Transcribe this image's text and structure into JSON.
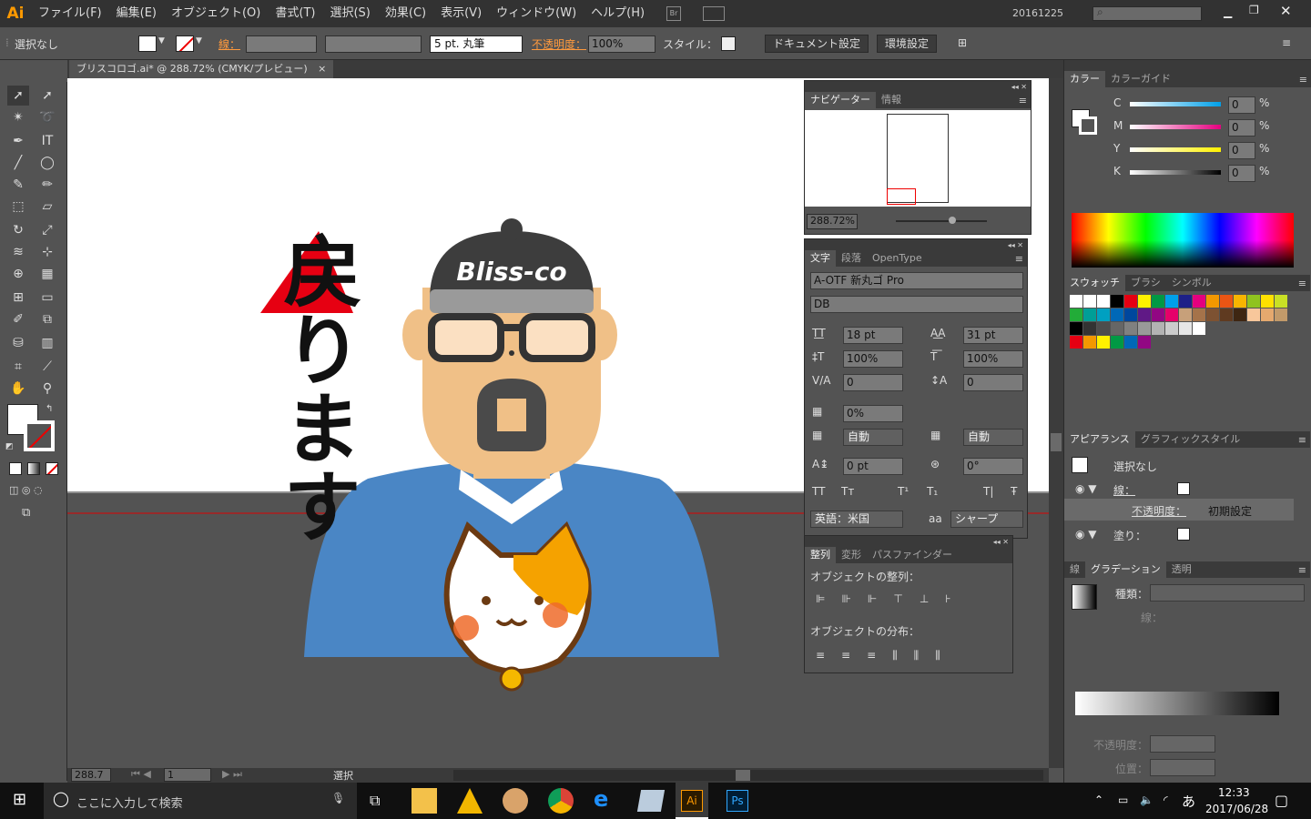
{
  "app": {
    "logo": "Ai"
  },
  "menu": [
    "ファイル(F)",
    "編集(E)",
    "オブジェクト(O)",
    "書式(T)",
    "選択(S)",
    "効果(C)",
    "表示(V)",
    "ウィンドウ(W)",
    "ヘルプ(H)"
  ],
  "workspace": "20161225",
  "control": {
    "selection": "選択なし",
    "stroke_label": "線：",
    "brush": "5 pt. 丸筆",
    "opacity_label": "不透明度：",
    "opacity": "100%",
    "style_label": "スタイル：",
    "doc_setup": "ドキュメント設定",
    "prefs": "環境設定"
  },
  "document": {
    "tab": "ブリスコロゴ.ai* @ 288.72% (CMYK/プレビュー)"
  },
  "artwork": {
    "vertical_text": "戻ります",
    "cap_text": "Bliss-co",
    "triangle_color": "#e60012"
  },
  "status": {
    "zoom": "288.7",
    "artboard": "1",
    "tool": "選択"
  },
  "navigator": {
    "tabs": [
      "ナビゲーター",
      "情報"
    ],
    "zoom": "288.72%"
  },
  "character": {
    "tabs": [
      "文字",
      "段落",
      "OpenType"
    ],
    "font": "A-OTF 新丸ゴ Pro",
    "style": "DB",
    "size": "18 pt",
    "leading": "31 pt",
    "vscale": "100%",
    "hscale": "100%",
    "kerning": "0",
    "tracking": "0",
    "tsume": "0%",
    "aki1": "自動",
    "aki2": "自動",
    "baseline": "0 pt",
    "rotation": "0°",
    "tt": [
      "TT",
      "Tт",
      "T¹",
      "T₁",
      "T|",
      "Ŧ"
    ],
    "lang": "英語：米国",
    "aa_label": "aa",
    "aa": "シャープ"
  },
  "align": {
    "tabs": [
      "整列",
      "変形",
      "パスファインダー"
    ],
    "align_label": "オブジェクトの整列：",
    "dist_label": "オブジェクトの分布："
  },
  "color": {
    "tabs": [
      "カラー",
      "カラーガイド"
    ],
    "channels": [
      {
        "label": "C",
        "value": "0",
        "unit": "%",
        "hex": "#00a0e9"
      },
      {
        "label": "M",
        "value": "0",
        "unit": "%",
        "hex": "#e4007f"
      },
      {
        "label": "Y",
        "value": "0",
        "unit": "%",
        "hex": "#fff100"
      },
      {
        "label": "K",
        "value": "0",
        "unit": "%",
        "hex": "#000000"
      }
    ]
  },
  "swatches": {
    "tabs": [
      "スウォッチ",
      "ブラシ",
      "シンボル"
    ]
  },
  "appearance": {
    "tabs": [
      "アピアランス",
      "グラフィックスタイル"
    ],
    "title": "選択なし",
    "stroke": "線：",
    "opacity": "不透明度：",
    "opacity_val": "初期設定",
    "fill": "塗り："
  },
  "gradient": {
    "tabs": [
      "線",
      "グラデーション",
      "透明"
    ],
    "type": "種類：",
    "stroke": "線：",
    "opacity": "不透明度：",
    "position": "位置："
  },
  "taskbar": {
    "search": "ここに入力して検索",
    "time": "12:33",
    "date": "2017/06/28",
    "ime": "あ"
  }
}
